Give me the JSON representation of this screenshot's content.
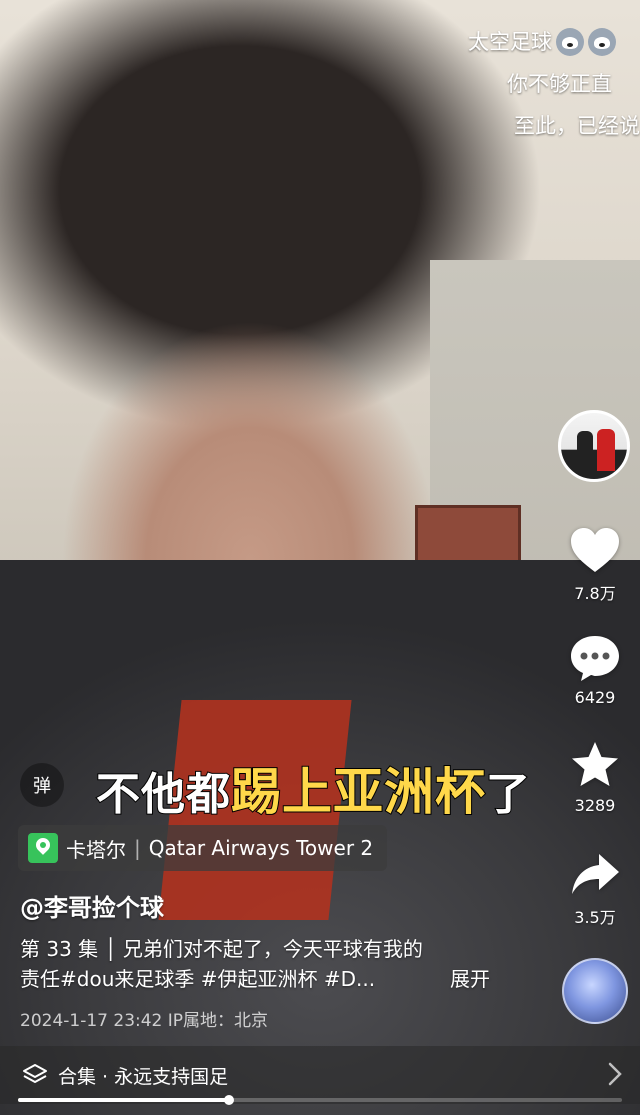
{
  "danmaku_lines": [
    "太空足球",
    "你不够正直",
    "至此，已经说"
  ],
  "caption": {
    "part1": "不他都",
    "part2": "踢上亚洲杯",
    "part3": "了"
  },
  "danmaku_toggle_label": "弹",
  "actions": {
    "likes": "7.8万",
    "comments": "6429",
    "favorites": "3289",
    "shares": "3.5万"
  },
  "location": {
    "city": "卡塔尔",
    "place": "Qatar Airways Tower 2"
  },
  "author": "@李哥捡个球",
  "description": {
    "line1": "第 33 集 │ 兄弟们对不起了，今天平球有我的",
    "line2": "责任#dou来足球季 #伊起亚洲杯 #D...",
    "expand": "展开"
  },
  "meta": {
    "datetime": "2024-1-17 23:42",
    "ip_label": "IP属地：北京"
  },
  "collection": {
    "label": "合集 · 永远支持国足"
  },
  "progress": {
    "fraction": 0.35
  }
}
